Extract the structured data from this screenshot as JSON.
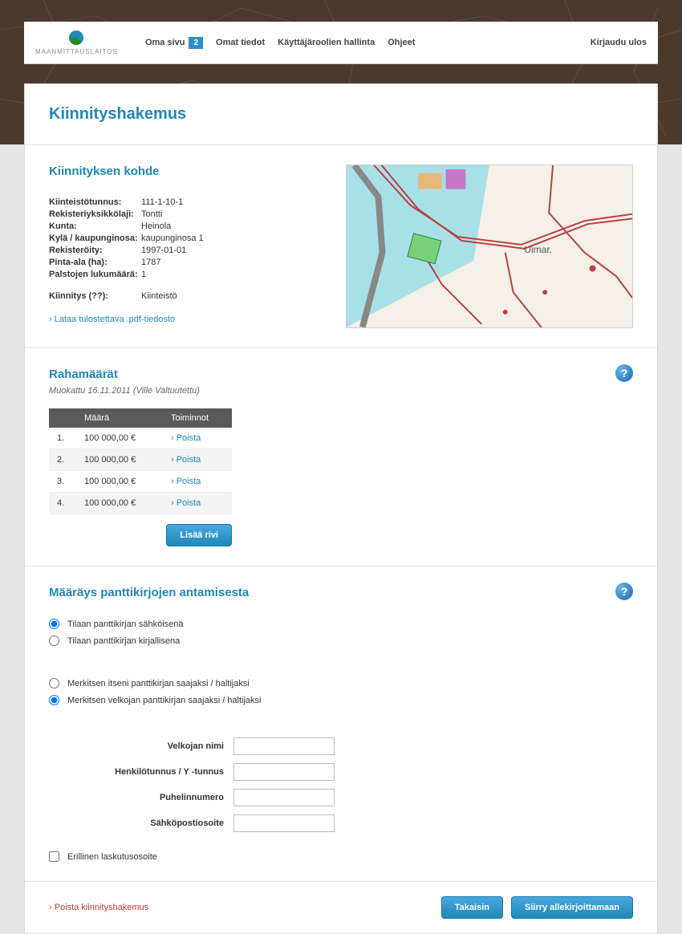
{
  "brand": {
    "name": "MAANMITTAUSLAITOS"
  },
  "nav": {
    "oma_sivu": "Oma sivu",
    "oma_sivu_badge": "2",
    "omat_tiedot": "Omat tiedot",
    "kayttajaroolien": "Käyttäjäroolien hallinta",
    "ohjeet": "Ohjeet",
    "logout": "Kirjaudu ulos"
  },
  "page_title": "Kiinnityshakemus",
  "kohde": {
    "title": "Kiinnityksen kohde",
    "labels": {
      "kiinteistotunnus": "Kiinteistötunnus:",
      "rekisteriyksikkolaji": "Rekisteriyksikkölaji:",
      "kunta": "Kunta:",
      "kyla": "Kylä / kaupunginosa:",
      "rekisteroity": "Rekisteröity:",
      "pinta_ala": "Pinta-ala (ha):",
      "palstojen": "Palstojen lukumäärä:",
      "kiinnitys": "Kiinnitys (??):"
    },
    "values": {
      "kiinteistotunnus": "111-1-10-1",
      "rekisteriyksikkolaji": "Tontti",
      "kunta": "Heinola",
      "kyla": "kaupunginosa 1",
      "rekisteroity": "1997-01-01",
      "pinta_ala": "1787",
      "palstojen": "1",
      "kiinnitys": "Kiinteistö"
    },
    "pdf_link": "Lataa tulostettava .pdf-tiedosto",
    "map_label": "Uimar."
  },
  "amounts": {
    "title": "Rahamäärät",
    "subtitle": "Muokattu 16.11.2011 (Ville Valtuutettu)",
    "headers": {
      "maara": "Määrä",
      "toiminnot": "Toiminnot"
    },
    "rows": [
      {
        "idx": "1.",
        "amount": "100 000,00 €",
        "action": "Poista"
      },
      {
        "idx": "2.",
        "amount": "100 000,00 €",
        "action": "Poista"
      },
      {
        "idx": "3.",
        "amount": "100 000,00 €",
        "action": "Poista"
      },
      {
        "idx": "4.",
        "amount": "100 000,00 €",
        "action": "Poista"
      }
    ],
    "add_btn": "Lisää rivi"
  },
  "maarays": {
    "title": "Määräys panttikirjojen antamisesta",
    "radio1": {
      "a": "Tilaan panttikirjan sähköisenä",
      "b": "Tilaan panttikirjan kirjallisena"
    },
    "radio2": {
      "a": "Merkitsen itseni panttikirjan saajaksi / haltijaksi",
      "b": "Merkitsen velkojan panttikirjan saajaksi / haltijaksi"
    },
    "form": {
      "velkojan_nimi": "Velkojan nimi",
      "henkilotunnus": "Henkilötunnus / Y -tunnus",
      "puhelinnumero": "Puhelinnumero",
      "sahkoposti": "Sähköpostiosoite"
    },
    "erillinen": "Erillinen laskutusosoite"
  },
  "footer": {
    "delete_link": "Poista kiinnityshakemus",
    "takaisin": "Takaisin",
    "siirry": "Siirry allekirjoittamaan"
  },
  "help_glyph": "?"
}
